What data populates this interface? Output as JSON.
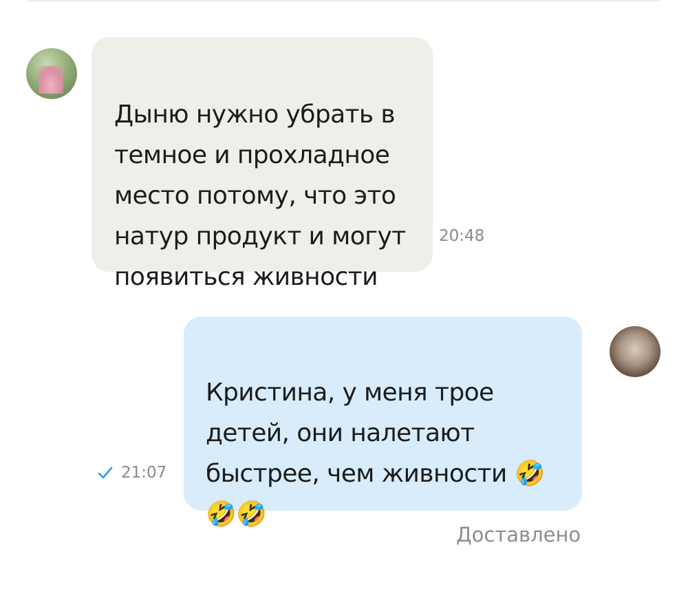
{
  "messages": {
    "incoming": {
      "text": "Дыню нужно убрать в\nтемное и прохладное\nместо потому, что это\nнатур продукт и могут\nпоявиться живности",
      "time": "20:48",
      "avatar_icon": "user-avatar-photo"
    },
    "outgoing": {
      "text": "Кристина, у меня трое\nдетей, они налетают\nбыстрее, чем живности 🤣\n🤣🤣",
      "time": "21:07",
      "status_icon": "checkmark-icon",
      "status_color": "#2a9cf0",
      "avatar_icon": "user-avatar-photo"
    }
  },
  "delivery_status": "Доставлено",
  "colors": {
    "incoming_bubble": "#efeee9",
    "outgoing_bubble": "#d8ecfc",
    "text": "#1c1c1c",
    "meta": "#8a8a8a"
  }
}
